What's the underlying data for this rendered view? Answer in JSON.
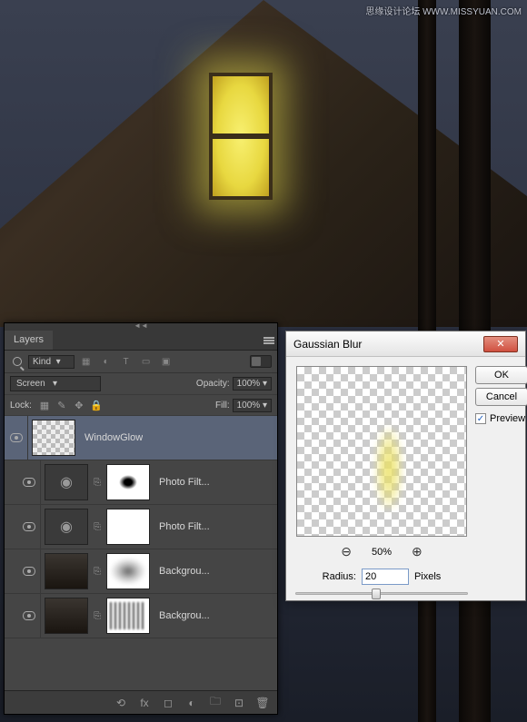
{
  "watermark": "思缘设计论坛  WWW.MISSYUAN.COM",
  "layers_panel": {
    "tab_label": "Layers",
    "kind_label": "Kind",
    "blend_mode": "Screen",
    "opacity_label": "Opacity:",
    "opacity_value": "100%",
    "lock_label": "Lock:",
    "fill_label": "Fill:",
    "fill_value": "100%",
    "layers": [
      {
        "name": "WindowGlow"
      },
      {
        "name": "Photo Filt..."
      },
      {
        "name": "Photo Filt..."
      },
      {
        "name": "Backgrou..."
      },
      {
        "name": "Backgrou..."
      }
    ]
  },
  "dialog": {
    "title": "Gaussian Blur",
    "ok": "OK",
    "cancel": "Cancel",
    "preview_label": "Preview",
    "zoom_pct": "50%",
    "radius_label": "Radius:",
    "radius_value": "20",
    "radius_unit": "Pixels"
  }
}
